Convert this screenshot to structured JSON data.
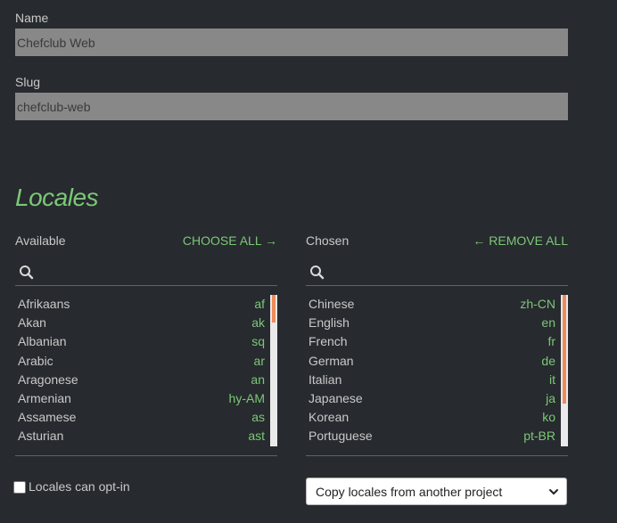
{
  "name_field": {
    "label": "Name",
    "value": "Chefclub Web"
  },
  "slug_field": {
    "label": "Slug",
    "value": "chefclub-web"
  },
  "locales": {
    "heading": "Locales",
    "available": {
      "label": "Available",
      "action": "CHOOSE ALL →",
      "search_value": "",
      "scroll_fraction": 0.18,
      "items": [
        {
          "name": "Afrikaans",
          "code": "af"
        },
        {
          "name": "Akan",
          "code": "ak"
        },
        {
          "name": "Albanian",
          "code": "sq"
        },
        {
          "name": "Arabic",
          "code": "ar"
        },
        {
          "name": "Aragonese",
          "code": "an"
        },
        {
          "name": "Armenian",
          "code": "hy-AM"
        },
        {
          "name": "Assamese",
          "code": "as"
        },
        {
          "name": "Asturian",
          "code": "ast"
        }
      ]
    },
    "chosen": {
      "label": "Chosen",
      "action": "← REMOVE ALL",
      "search_value": "",
      "scroll_fraction": 0.72,
      "items": [
        {
          "name": "Chinese",
          "code": "zh-CN"
        },
        {
          "name": "English",
          "code": "en"
        },
        {
          "name": "French",
          "code": "fr"
        },
        {
          "name": "German",
          "code": "de"
        },
        {
          "name": "Italian",
          "code": "it"
        },
        {
          "name": "Japanese",
          "code": "ja"
        },
        {
          "name": "Korean",
          "code": "ko"
        },
        {
          "name": "Portuguese",
          "code": "pt-BR"
        }
      ]
    },
    "opt_in": {
      "label": "Locales can opt-in",
      "checked": false
    },
    "copy_select": {
      "value": "Copy locales from another project"
    }
  },
  "colors": {
    "background": "#272a2f",
    "accent_green": "#7bc876",
    "scroll_thumb": "#ef8c5b",
    "input_bg": "#888888"
  },
  "icons": [
    "search-icon",
    "chevron-down-icon"
  ]
}
